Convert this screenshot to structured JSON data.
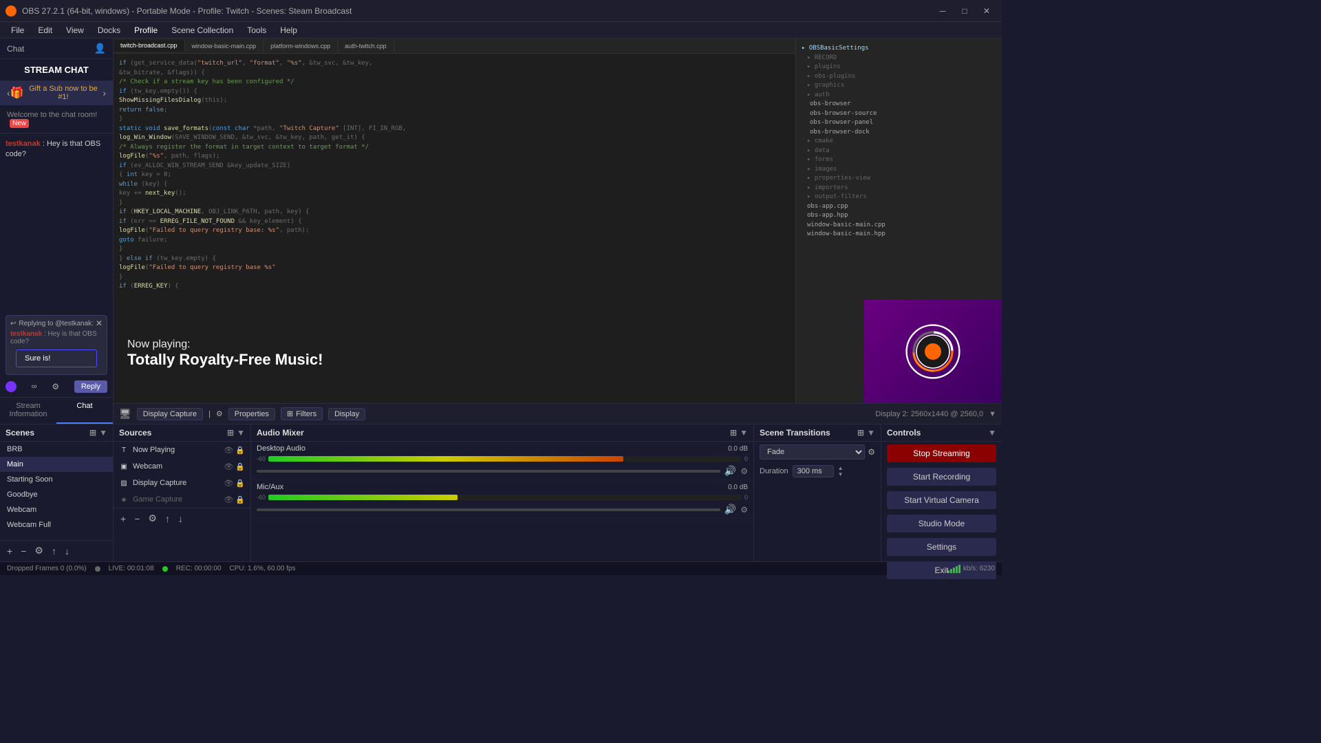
{
  "titleBar": {
    "title": "OBS 27.2.1 (64-bit, windows) - Portable Mode - Profile: Twitch - Scenes: Steam Broadcast",
    "icon": "obs-icon"
  },
  "menuBar": {
    "items": [
      "File",
      "Edit",
      "View",
      "Docks",
      "Profile",
      "Scene Collection",
      "Tools",
      "Help"
    ]
  },
  "chat": {
    "header": "Chat",
    "streamChatTitle": "STREAM CHAT",
    "giftBanner": "Gift a Sub now to be #1!",
    "welcomeMessage": "Welcome to the chat room!",
    "newLabel": "New",
    "messages": [
      {
        "username": "testkanak",
        "text": "Hey is that OBS code?"
      }
    ],
    "replyingTo": "Replying to @testkanak:",
    "replyOriginalUser": "testkanak",
    "replyOriginalText": "Hey is that OBS code?",
    "inputValue": "Sure is!",
    "replyButtonLabel": "Reply",
    "infinityLabel": "∞"
  },
  "tabs": {
    "streamInfo": "Stream Information",
    "chat": "Chat"
  },
  "preview": {
    "displayCapture": "Display Capture",
    "propertiesLabel": "Properties",
    "filtersLabel": "Filters",
    "displayLabel": "Display",
    "displayInfo": "Display 2: 2560x1440 @ 2560,0",
    "nowPlaying": {
      "label": "Now playing:",
      "title": "Totally Royalty-Free Music!"
    }
  },
  "scenes": {
    "title": "Scenes",
    "items": [
      "BRB",
      "Main",
      "Starting Soon",
      "Goodbye",
      "Webcam",
      "Webcam Full"
    ],
    "activeIndex": 1
  },
  "sources": {
    "title": "Sources",
    "items": [
      {
        "name": "Now Playing",
        "icon": "T",
        "visible": true,
        "locked": true
      },
      {
        "name": "Webcam",
        "icon": "▣",
        "visible": true,
        "locked": true
      },
      {
        "name": "Display Capture",
        "icon": "▨",
        "visible": true,
        "locked": true
      },
      {
        "name": "Game Capture",
        "icon": "◈",
        "visible": false,
        "locked": true
      }
    ]
  },
  "audioMixer": {
    "title": "Audio Mixer",
    "tracks": [
      {
        "name": "Desktop Audio",
        "db": "0.0 dB",
        "level": 75
      },
      {
        "name": "Mic/Aux",
        "db": "0.0 dB",
        "level": 40
      }
    ]
  },
  "sceneTransitions": {
    "title": "Scene Transitions",
    "selectedTransition": "Fade",
    "durationLabel": "Duration",
    "durationValue": "300 ms"
  },
  "controls": {
    "title": "Controls",
    "buttons": {
      "stopStreaming": "Stop Streaming",
      "startRecording": "Start Recording",
      "startVirtualCamera": "Start Virtual Camera",
      "studioMode": "Studio Mode",
      "settings": "Settings",
      "exit": "Exit"
    }
  },
  "statusBar": {
    "droppedFrames": "Dropped Frames 0 (0.0%)",
    "live": "LIVE: 00:01:08",
    "rec": "REC: 00:00:00",
    "cpu": "CPU: 1.6%, 60.00 fps",
    "kbps": "kb/s: 6230"
  }
}
